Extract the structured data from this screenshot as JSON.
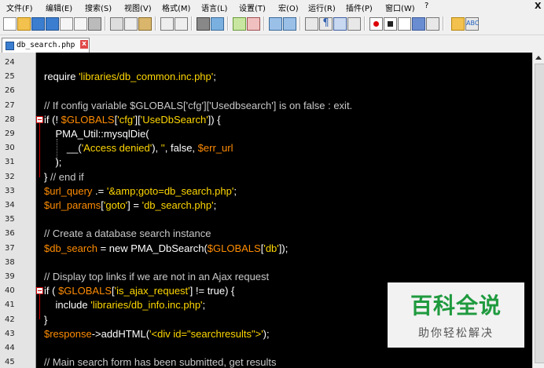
{
  "menu": {
    "items": [
      "文件(F)",
      "编辑(E)",
      "搜索(S)",
      "视图(V)",
      "格式(M)",
      "语言(L)",
      "设置(T)",
      "宏(O)",
      "运行(R)",
      "插件(P)",
      "窗口(W)",
      "?"
    ],
    "close_glyph": "X"
  },
  "tab": {
    "label": "db_search.php",
    "close_glyph": "x"
  },
  "editor": {
    "lines": [
      {
        "n": "24",
        "segs": []
      },
      {
        "n": "25",
        "segs": [
          [
            "kw",
            "require "
          ],
          [
            "str",
            "'libraries/db_common.inc.php'"
          ],
          [
            "wh",
            ";"
          ]
        ]
      },
      {
        "n": "26",
        "segs": []
      },
      {
        "n": "27",
        "segs": [
          [
            "cm",
            "// If config variable $GLOBALS['cfg']['Usedbsearch'] is on false : exit."
          ]
        ]
      },
      {
        "n": "28",
        "segs": [
          [
            "kw",
            "if (! "
          ],
          [
            "var",
            "$GLOBALS"
          ],
          [
            "wh",
            "["
          ],
          [
            "str",
            "'cfg'"
          ],
          [
            "wh",
            "]["
          ],
          [
            "str",
            "'UseDbSearch'"
          ],
          [
            "wh",
            "]) {"
          ]
        ]
      },
      {
        "n": "29",
        "segs": [
          [
            "wh",
            "    PMA_Util::mysqlDie("
          ]
        ]
      },
      {
        "n": "30",
        "segs": [
          [
            "wh",
            "        __("
          ],
          [
            "str",
            "'Access denied'"
          ],
          [
            "wh",
            "), "
          ],
          [
            "str",
            "''"
          ],
          [
            "wh",
            ", false, "
          ],
          [
            "var",
            "$err_url"
          ]
        ]
      },
      {
        "n": "31",
        "segs": [
          [
            "wh",
            "    );"
          ]
        ]
      },
      {
        "n": "32",
        "segs": [
          [
            "wh",
            "} "
          ],
          [
            "cm",
            "// end if"
          ]
        ]
      },
      {
        "n": "33",
        "segs": [
          [
            "var",
            "$url_query"
          ],
          [
            "wh",
            " .= "
          ],
          [
            "str",
            "'&amp;goto=db_search.php'"
          ],
          [
            "wh",
            ";"
          ]
        ]
      },
      {
        "n": "34",
        "segs": [
          [
            "var",
            "$url_params"
          ],
          [
            "wh",
            "["
          ],
          [
            "str",
            "'goto'"
          ],
          [
            "wh",
            "] = "
          ],
          [
            "str",
            "'db_search.php'"
          ],
          [
            "wh",
            ";"
          ]
        ]
      },
      {
        "n": "35",
        "segs": []
      },
      {
        "n": "36",
        "segs": [
          [
            "cm",
            "// Create a database search instance"
          ]
        ]
      },
      {
        "n": "37",
        "segs": [
          [
            "var",
            "$db_search"
          ],
          [
            "wh",
            " = new PMA_DbSearch("
          ],
          [
            "var",
            "$GLOBALS"
          ],
          [
            "wh",
            "["
          ],
          [
            "str",
            "'db'"
          ],
          [
            "wh",
            "]);"
          ]
        ]
      },
      {
        "n": "38",
        "segs": []
      },
      {
        "n": "39",
        "segs": [
          [
            "cm",
            "// Display top links if we are not in an Ajax request"
          ]
        ]
      },
      {
        "n": "40",
        "segs": [
          [
            "kw",
            "if ( "
          ],
          [
            "var",
            "$GLOBALS"
          ],
          [
            "wh",
            "["
          ],
          [
            "str",
            "'is_ajax_request'"
          ],
          [
            "wh",
            "] != true) {"
          ]
        ]
      },
      {
        "n": "41",
        "segs": [
          [
            "wh",
            "    include "
          ],
          [
            "str",
            "'libraries/db_info.inc.php'"
          ],
          [
            "wh",
            ";"
          ]
        ]
      },
      {
        "n": "42",
        "segs": [
          [
            "wh",
            "}"
          ]
        ]
      },
      {
        "n": "43",
        "segs": [
          [
            "var",
            "$response"
          ],
          [
            "wh",
            "->addHTML("
          ],
          [
            "str",
            "'<div id=\"searchresults\">'"
          ],
          [
            "wh",
            ");"
          ]
        ]
      },
      {
        "n": "44",
        "segs": []
      },
      {
        "n": "45",
        "segs": [
          [
            "cm",
            "// Main search form has been submitted, get results"
          ]
        ]
      }
    ]
  },
  "watermark": {
    "title": "百科全说",
    "subtitle": "助你轻松解决"
  },
  "colors": {
    "background": "#000000",
    "comment": "#c8c8c8",
    "string": "#ffd700",
    "variable": "#ff8c00",
    "text": "#ffffff",
    "fold_marker": "#cc0000",
    "watermark_green": "#1f9a3e"
  }
}
